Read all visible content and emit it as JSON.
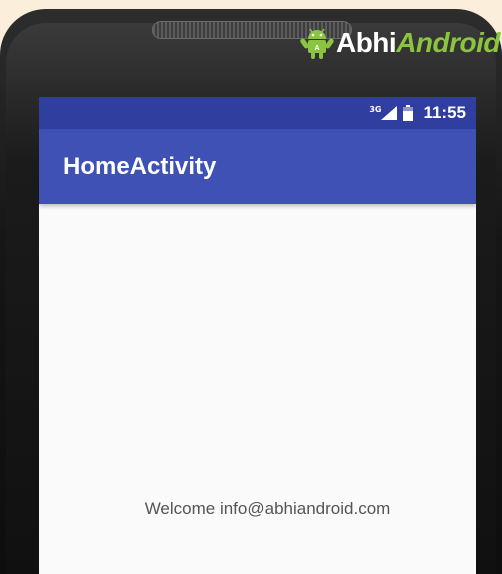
{
  "brand": {
    "name_part1": "Abhi",
    "name_part2": "Android",
    "logo_icon": "android-mascot-icon",
    "accent_color": "#8bc43f"
  },
  "status_bar": {
    "network": "3G",
    "time": "11:55",
    "color": "#303f9f",
    "icons": [
      "signal-icon",
      "battery-icon"
    ]
  },
  "app_bar": {
    "title": "HomeActivity",
    "color": "#3f51b5"
  },
  "content": {
    "welcome_message": "Welcome info@abhiandroid.com"
  }
}
